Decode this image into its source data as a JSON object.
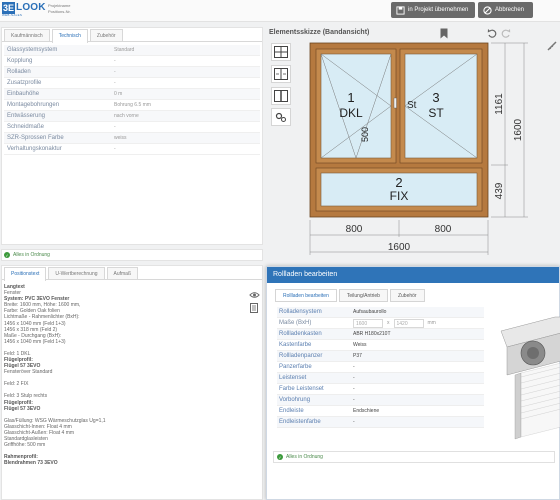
{
  "header": {
    "logo_box": "3E",
    "logo_word": "LOOK",
    "logo_sub": "WEB-SALES",
    "proj_label": "Projektname",
    "pos_label": "Positions-Nr.",
    "take_label": "in Projekt übernehmen",
    "cancel_label": "Abbrechen"
  },
  "top_tabs": [
    "Kaufmännisch",
    "Technisch",
    "Zubehör"
  ],
  "properties": [
    {
      "label": "Glassystemsystem",
      "value": "Standard"
    },
    {
      "label": "Kopplung",
      "value": "-"
    },
    {
      "label": "Rolladen",
      "value": "-"
    },
    {
      "label": "Zusatzprofile",
      "value": "-"
    },
    {
      "label": "Einbauhöhe",
      "value": "0 m"
    },
    {
      "label": "Montagebohrungen",
      "value": "Bohrung 6.5 mm"
    },
    {
      "label": "Entwässerung",
      "value": "nach vorne"
    },
    {
      "label": "Schneidmaße",
      "value": "-"
    },
    {
      "label": "SZR-Sprossen Farbe",
      "value": "weiss"
    },
    {
      "label": "Verhaltungskonaktur",
      "value": "-"
    }
  ],
  "status_ok": "Alles in Ordnung",
  "bottom_tabs": [
    "Positionstext",
    "U-Wertberechnung",
    "Aufmaß"
  ],
  "longtext": [
    {
      "t": "Langtext",
      "b": true
    },
    {
      "t": "Fenster",
      "b": false
    },
    {
      "t": "System: PVC 3EVO Fenster",
      "b": true
    },
    {
      "t": "Breite: 1600 mm, Höhe: 1600 mm,",
      "b": false
    },
    {
      "t": "Farbe: Golden Oak folien",
      "b": false
    },
    {
      "t": "Lichtmaße - Rahmenlichter (BxH):",
      "b": false
    },
    {
      "t": "1456 x 1040 mm (Feld 1+3)",
      "b": false
    },
    {
      "t": "1456 x 318 mm (Feld 2)",
      "b": false
    },
    {
      "t": "Maße - Durchgang (BxH):",
      "b": false
    },
    {
      "t": "1456 x 1040 mm (Feld 1+3)",
      "b": false
    },
    {
      "t": "",
      "b": false
    },
    {
      "t": "Feld: 1 DKL",
      "b": false
    },
    {
      "t": "Flügelprofil:",
      "b": true
    },
    {
      "t": "Flügel 57 3EVO",
      "b": true
    },
    {
      "t": "Fensteröver Standard",
      "b": false
    },
    {
      "t": "",
      "b": false
    },
    {
      "t": "Feld: 2 FIX",
      "b": false
    },
    {
      "t": "",
      "b": false
    },
    {
      "t": "Feld: 3 Stulp rechts",
      "b": false
    },
    {
      "t": "Flügelprofil:",
      "b": true
    },
    {
      "t": "Flügel 57 3EVO",
      "b": true
    },
    {
      "t": "",
      "b": false
    },
    {
      "t": "Glas/Füllung: WSG Wärmeschutzglas Ug=1,1",
      "b": false
    },
    {
      "t": "Glasschicht-Innen: Float 4 mm",
      "b": false
    },
    {
      "t": "Glasschicht-Außen: Float 4 mm",
      "b": false
    },
    {
      "t": "Standardglasleisten",
      "b": false
    },
    {
      "t": "Griffhöhe: 500 mm",
      "b": false
    },
    {
      "t": "",
      "b": false
    },
    {
      "t": "Rahmenprofil:",
      "b": true
    },
    {
      "t": "Blendrahmen 73 3EVO",
      "b": true
    }
  ],
  "sketch": {
    "title": "Elementsskizze (Bandansicht)",
    "f1_num": "1",
    "f1_type": "DKL",
    "f3_num": "3",
    "f3_type": "ST",
    "st_label": "St",
    "handle_h": "500",
    "f2_num": "2",
    "f2_type": "FIX",
    "dim_w1": "800",
    "dim_w2": "800",
    "dim_w": "1600",
    "dim_h1": "1161",
    "dim_h2": "439",
    "dim_h": "1600",
    "frame_color": "#b5793f",
    "glass_color": "#d8ecf5"
  },
  "dialog": {
    "title": "Rollladen bearbeiten",
    "tabs": [
      "Rollladen bearbeiten",
      "Teilung/Antrieb",
      "Zubehör"
    ],
    "rows": [
      {
        "label": "Rolladensystem",
        "value": "Aufsaubaurollo"
      },
      {
        "label": "Maße (BxH)",
        "w": "1600",
        "x": "x",
        "h": "1420",
        "unit": "mm"
      },
      {
        "label": "Rollladenkasten",
        "value": "ABR H180x210T"
      },
      {
        "label": "Kastenfarbe",
        "value": "Weiss"
      },
      {
        "label": "Rollladenpanzer",
        "value": "P37"
      },
      {
        "label": "Panzerfarbe",
        "value": "-"
      },
      {
        "label": "Leistenset",
        "value": "-"
      },
      {
        "label": "Farbe Leistenset",
        "value": "-"
      },
      {
        "label": "Vorbohrung",
        "value": "-"
      },
      {
        "label": "Endleiste",
        "value": "Endschiene"
      },
      {
        "label": "Endleistenfarbe",
        "value": "-"
      }
    ],
    "status": "Alles in Ordnung"
  },
  "colors": {
    "accent": "#2f74b8",
    "ok": "#3c9a3c"
  }
}
